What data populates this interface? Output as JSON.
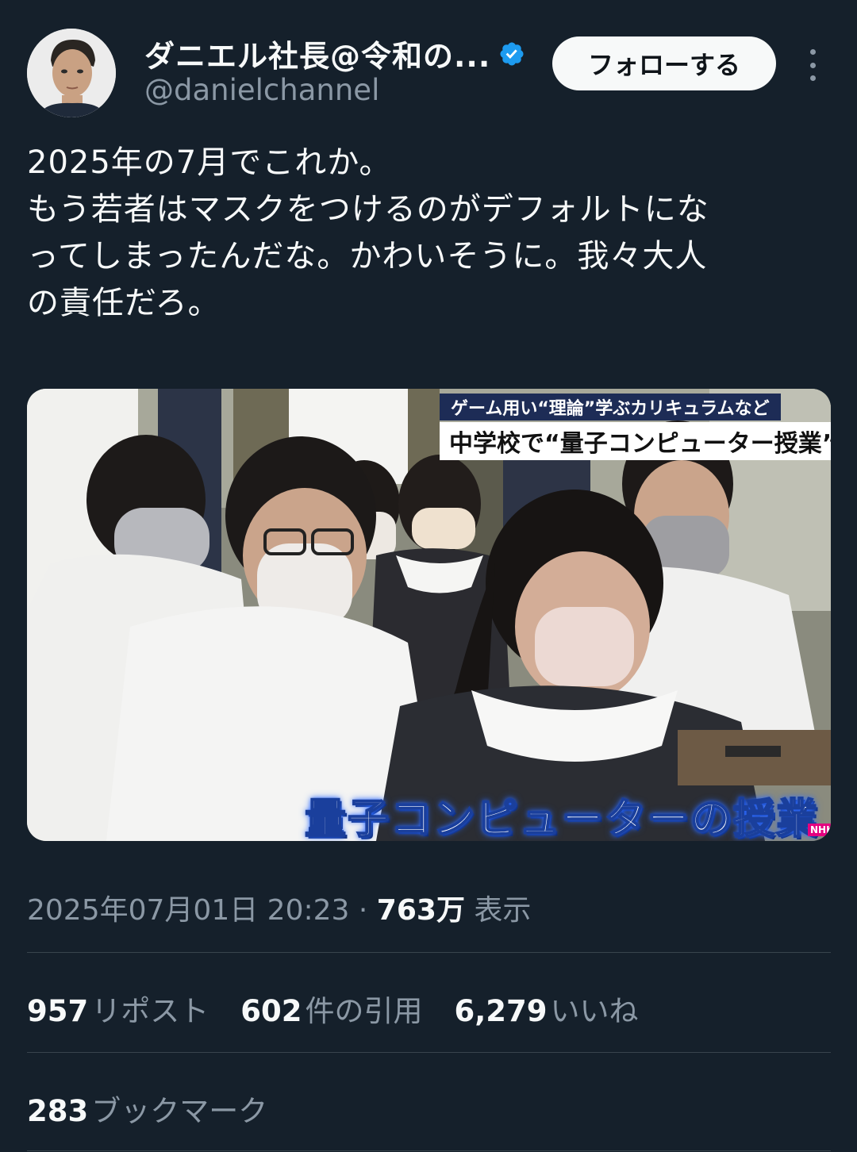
{
  "author": {
    "display_name": "ダニエル社長@令和の...",
    "handle": "@danielchannel",
    "verified": true,
    "verified_color": "#1d9bf0"
  },
  "actions": {
    "follow_label": "フォローする"
  },
  "tweet": {
    "text": "2025年の7月でこれか。\nもう若者はマスクをつけるのがデフォルトにな\nってしまったんだな。かわいそうに。我々大人\nの責任だろ。"
  },
  "media": {
    "caption_top_small": "ゲーム用い“理論”学ぶカリキュラムなど",
    "caption_top_large": "中学校で“量子コンピューター授業”",
    "caption_bottom": "量子コンピューターの授業",
    "channel_logo": "NHK"
  },
  "meta": {
    "timestamp": "2025年07月01日 20:23",
    "separator": "·",
    "views_count": "763万",
    "views_label": "表示"
  },
  "stats": {
    "reposts_count": "957",
    "reposts_label": "リポスト",
    "quotes_count": "602",
    "quotes_label": "件の引用",
    "likes_count": "6,279",
    "likes_label": "いいね",
    "bookmarks_count": "283",
    "bookmarks_label": "ブックマーク"
  }
}
